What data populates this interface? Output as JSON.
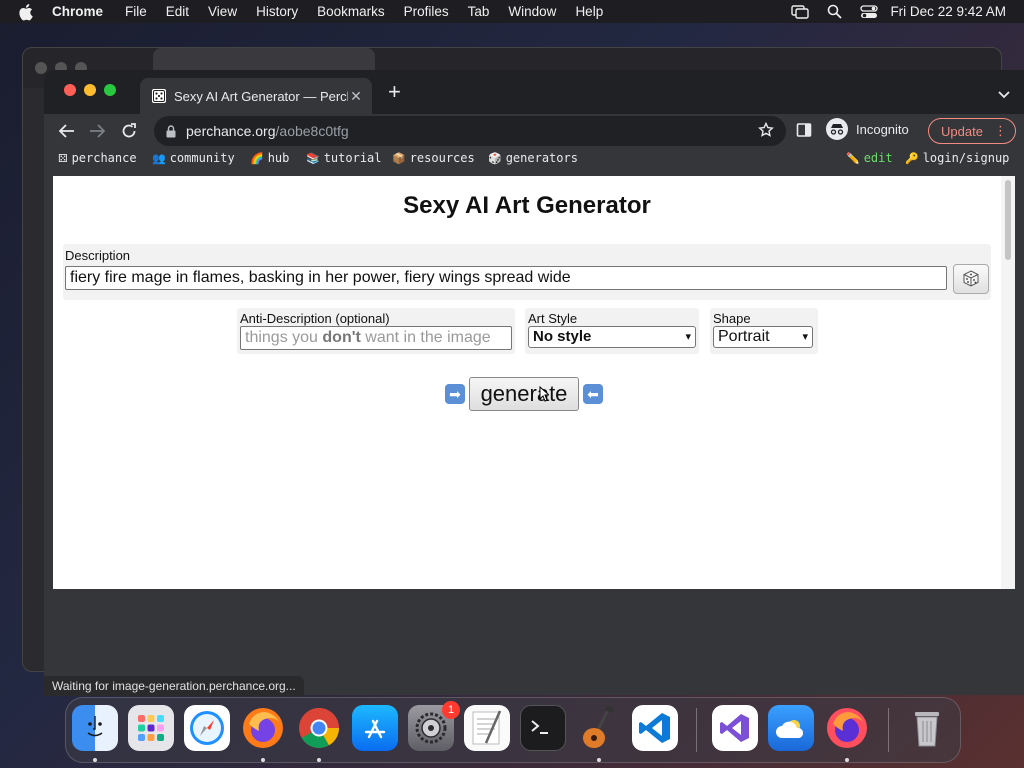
{
  "menubar": {
    "app_name": "Chrome",
    "items": [
      "File",
      "Edit",
      "View",
      "History",
      "Bookmarks",
      "Profiles",
      "Tab",
      "Window",
      "Help"
    ],
    "clock": "Fri Dec 22  9:42 AM"
  },
  "browser": {
    "tab_title": "Sexy AI Art Generator — Perch",
    "url_host": "perchance.org",
    "url_path": "/aobe8c0tfg",
    "incognito_label": "Incognito",
    "update_label": "Update"
  },
  "bookmarks": {
    "perchance": "perchance",
    "community": "community",
    "hub": "hub",
    "tutorial": "tutorial",
    "resources": "resources",
    "generators": "generators",
    "edit": "edit",
    "login": "login/signup"
  },
  "page": {
    "title": "Sexy AI Art Generator",
    "description_label": "Description",
    "description_value": "fiery fire mage in flames, basking in her power, fiery wings spread wide",
    "anti_label": "Anti-Description (optional)",
    "anti_placeholder_pre": "things you ",
    "anti_placeholder_bold": "don't",
    "anti_placeholder_post": " want in the image",
    "style_label": "Art Style",
    "style_value": "No style",
    "shape_label": "Shape",
    "shape_value": "Portrait",
    "generate_label": "generate"
  },
  "status": {
    "text": "Waiting for image-generation.perchance.org..."
  },
  "dock": {
    "settings_badge": "1"
  },
  "colors": {
    "update_accent": "#f28b82",
    "edit_green": "#6ddb6d",
    "badge_red": "#ff3b30"
  }
}
